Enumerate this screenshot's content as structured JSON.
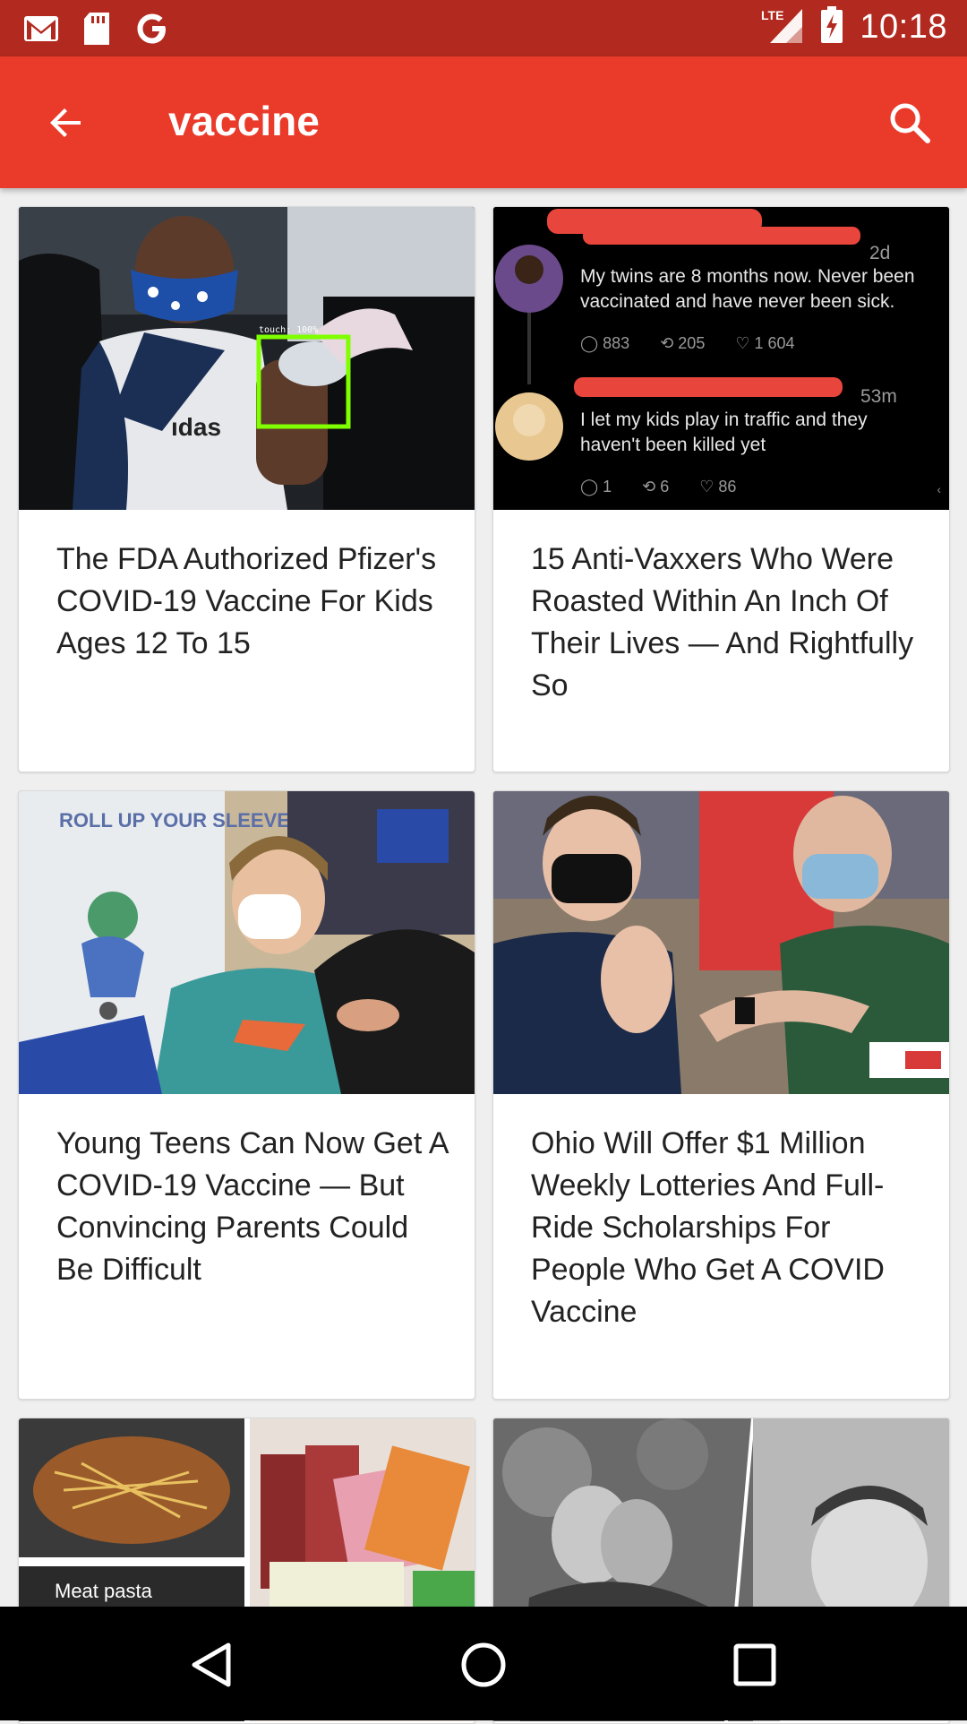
{
  "status_bar": {
    "time": "10:18",
    "network": "LTE",
    "left_icons": [
      "gmail-icon",
      "sd-card-icon",
      "google-icon"
    ]
  },
  "app_bar": {
    "title": "vaccine",
    "back_icon": "arrow-back-icon",
    "search_icon": "search-icon"
  },
  "articles": [
    {
      "headline": "The FDA Authorized Pfizer's COVID-19 Vaccine For Kids Ages 12 To 15",
      "image_overlay_text": "touch: 100%"
    },
    {
      "headline": "15 Anti-Vaxxers Who Were Roasted Within An Inch Of Their Lives — And Rightfully So",
      "tweets": [
        {
          "age": "2d",
          "text": "My twins are 8 months now. Never been vaccinated and have never been sick.",
          "replies": "883",
          "retweets": "205",
          "likes": "1 604"
        },
        {
          "age": "53m",
          "text": "I let my kids play in traffic and they haven't been killed yet",
          "replies": "1",
          "retweets": "6",
          "likes": "86"
        }
      ]
    },
    {
      "headline": "Young Teens Can Now Get A COVID-19 Vaccine — But Convincing Parents Could Be Difficult",
      "image_poster_text": "ROLL UP YOUR SLEEVE"
    },
    {
      "headline": "Ohio Will Offer $1 Million Weekly Lotteries And Full-Ride Scholarships For People Who Get A COVID Vaccine"
    },
    {
      "headline": "",
      "image_caption": "Meat pasta"
    },
    {
      "headline": ""
    }
  ],
  "colors": {
    "status_bar": "#b22a1f",
    "app_bar": "#e93a2a",
    "background": "#efefef"
  }
}
